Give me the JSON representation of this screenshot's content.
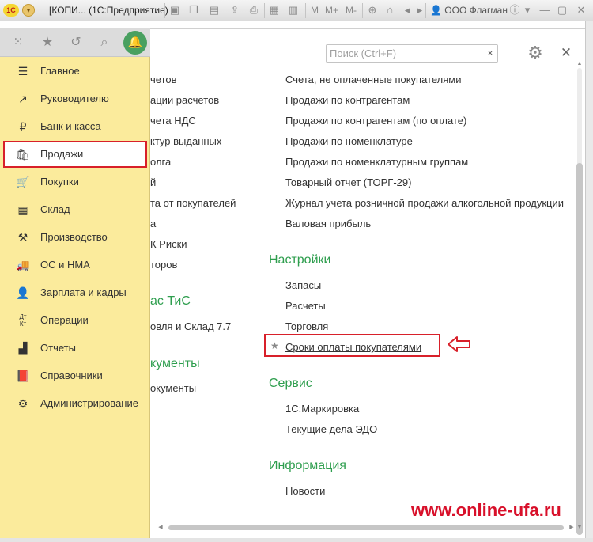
{
  "titlebar": {
    "logo": "1С",
    "title": "[КОПИ...   (1С:Предприятие)",
    "memory_buttons": [
      "M",
      "M+",
      "M-"
    ],
    "company": "ООО Флагман",
    "icons": [
      "menu-icon",
      "home-icon",
      "save-icon",
      "print-icon",
      "calendar-icon",
      "calculator-icon",
      "zoom-icon",
      "user-icon",
      "info-icon",
      "minimize-icon",
      "maximize-icon",
      "close-icon"
    ]
  },
  "sidepanel": {
    "top_icons": [
      "apps-grid-icon",
      "favorites-star-icon",
      "history-icon",
      "search-icon",
      "bell-icon"
    ],
    "items": [
      {
        "label": "Главное",
        "icon": "menu-lines-icon"
      },
      {
        "label": "Руководителю",
        "icon": "trend-up-icon"
      },
      {
        "label": "Банк и касса",
        "icon": "ruble-coin-icon"
      },
      {
        "label": "Продажи",
        "icon": "shopping-bag-icon",
        "active": true
      },
      {
        "label": "Покупки",
        "icon": "cart-icon"
      },
      {
        "label": "Склад",
        "icon": "warehouse-grid-icon"
      },
      {
        "label": "Производство",
        "icon": "factory-icon"
      },
      {
        "label": "ОС и НМА",
        "icon": "truck-icon"
      },
      {
        "label": "Зарплата и кадры",
        "icon": "person-icon"
      },
      {
        "label": "Операции",
        "icon": "debit-credit-icon"
      },
      {
        "label": "Отчеты",
        "icon": "bar-chart-icon"
      },
      {
        "label": "Справочники",
        "icon": "book-icon"
      },
      {
        "label": "Администрирование",
        "icon": "gear-icon"
      }
    ]
  },
  "search": {
    "placeholder": "Поиск (Ctrl+F)",
    "clear_label": "×"
  },
  "left_column": [
    "четов",
    "ации расчетов",
    "чета НДС",
    "ктур выданных",
    "олга",
    "й",
    "та от покупателей",
    "а",
    "К Риски",
    "торов",
    "ас ТиС",
    "овля и Склад 7.7",
    "кументы",
    "окументы"
  ],
  "right_column": {
    "reports": [
      "Счета, не оплаченные покупателями",
      "Продажи по контрагентам",
      "Продажи по контрагентам (по оплате)",
      "Продажи по номенклатуре",
      "Продажи по номенклатурным группам",
      "Товарный отчет (ТОРГ-29)",
      "Журнал учета розничной продажи алкогольной продукции",
      "Валовая прибыль"
    ],
    "settings_title": "Настройки",
    "settings": [
      "Запасы",
      "Расчеты",
      "Торговля"
    ],
    "highlighted_link": "Сроки оплаты покупателями",
    "service_title": "Сервис",
    "service": [
      "1С:Маркировка",
      "Текущие дела ЭДО"
    ],
    "info_title": "Информация",
    "info": [
      "Новости"
    ]
  },
  "watermark": "www.online-ufa.ru",
  "colors": {
    "accent_green": "#2e9e4e",
    "highlight_red": "#d8202a",
    "panel_yellow": "#fbeb9c",
    "watermark_red": "#d8102a"
  }
}
